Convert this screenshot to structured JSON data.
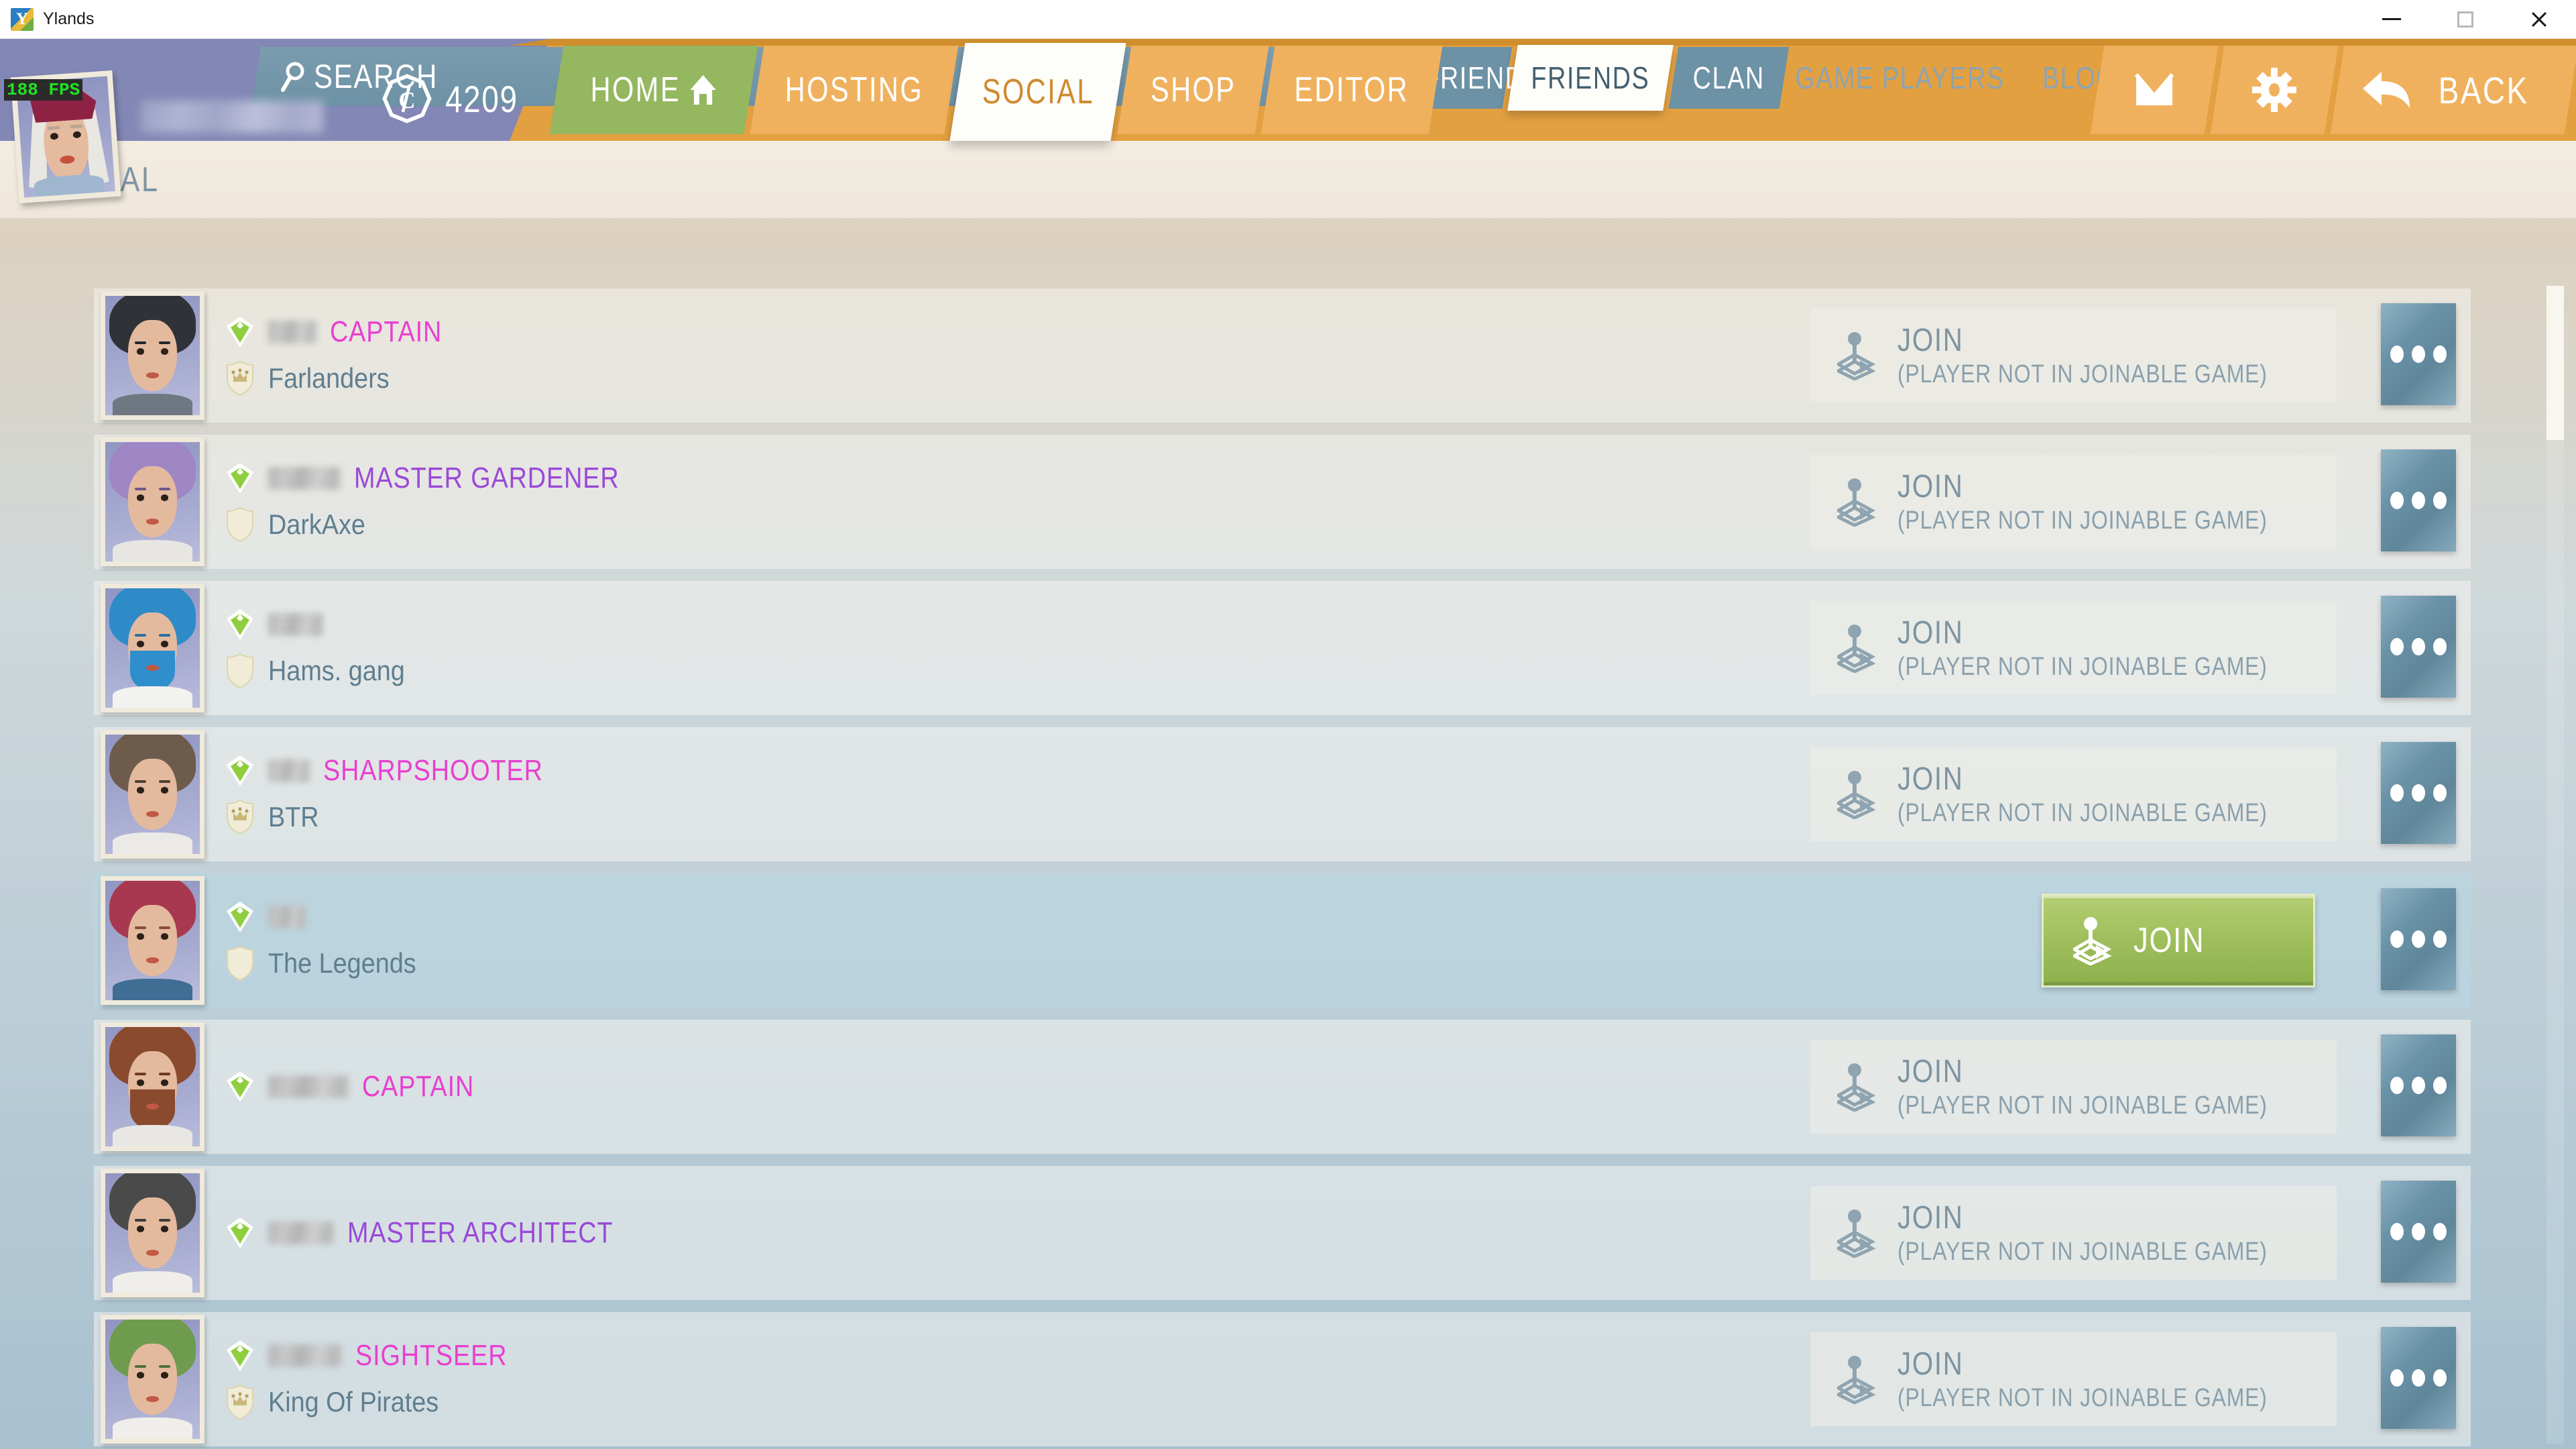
{
  "window": {
    "title": "Ylands",
    "app_icon": "ylands-logo-icon",
    "minimize": "minimize-icon",
    "maximize": "maximize-icon",
    "close": "close-icon"
  },
  "hud": {
    "fps": "188 FPS",
    "avatar": "player-avatar",
    "username": "",
    "currency_icon": "coin-icon",
    "currency_value": "4209"
  },
  "mainnav": {
    "tabs": [
      {
        "label": "HOME",
        "state": "home",
        "icon": "house-icon"
      },
      {
        "label": "HOSTING",
        "state": "orange",
        "icon": ""
      },
      {
        "label": "SOCIAL",
        "state": "active",
        "icon": ""
      },
      {
        "label": "SHOP",
        "state": "orange",
        "icon": ""
      },
      {
        "label": "EDITOR",
        "state": "orange",
        "icon": ""
      }
    ],
    "mail_icon": "mail-icon",
    "settings_icon": "gear-icon",
    "back_icon": "back-arrow-icon",
    "back_label": "BACK"
  },
  "subnav": {
    "breadcrumb": "SOCIAL",
    "search": {
      "icon": "search-icon",
      "placeholder": "SEARCH",
      "value": ""
    },
    "tabs": [
      {
        "label": "ADD NEW FRIEND",
        "state": "normal",
        "w": "w-addfriend"
      },
      {
        "label": "FRIENDS",
        "state": "active",
        "w": "w-friends"
      },
      {
        "label": "CLAN",
        "state": "normal",
        "w": "w-clan"
      },
      {
        "label": "GAME PLAYERS",
        "state": "disabled",
        "w": "w-gplayers"
      },
      {
        "label": "BLOCKED",
        "state": "disabled",
        "w": "w-blocked"
      }
    ]
  },
  "colors": {
    "rank_magenta": "#e93fd0",
    "rank_purple": "#9a49d8",
    "accent_orange": "#e3a040",
    "accent_green": "#94b760",
    "steel_blue": "#6d91a5",
    "clan_text": "#5f7e8f"
  },
  "friends_list": {
    "join_label": "JOIN",
    "join_disabled_note": "(PLAYER NOT IN JOINABLE GAME)",
    "more_button": "more-options-icon",
    "rows": [
      {
        "username": "",
        "name_blur_width": 72,
        "rank": "CAPTAIN",
        "rank_color": "magenta",
        "clan": "Farlanders",
        "clan_role": "leader",
        "status": "online",
        "joinable": false,
        "highlighted": false,
        "avatar": {
          "hair": "#2f3337",
          "brow": "#23272b",
          "body": "#6f7882",
          "beard": ""
        }
      },
      {
        "username": "",
        "name_blur_width": 108,
        "rank": "MASTER GARDENER",
        "rank_color": "purple",
        "clan": "DarkAxe",
        "clan_role": "member",
        "status": "online",
        "joinable": false,
        "highlighted": false,
        "avatar": {
          "hair": "#9f86c4",
          "brow": "#6d5a8a",
          "body": "#e8e6e2",
          "beard": ""
        }
      },
      {
        "username": "",
        "name_blur_width": 82,
        "rank": "",
        "rank_color": "magenta",
        "clan": "Hams. gang",
        "clan_role": "member",
        "status": "online",
        "joinable": false,
        "highlighted": false,
        "avatar": {
          "hair": "#2e8bc8",
          "brow": "#2a6f9e",
          "body": "#f2f2f0",
          "beard": "#2f8fcc"
        }
      },
      {
        "username": "",
        "name_blur_width": 62,
        "rank": "SHARPSHOOTER",
        "rank_color": "magenta",
        "clan": "BTR",
        "clan_role": "leader",
        "status": "online",
        "joinable": false,
        "highlighted": false,
        "avatar": {
          "hair": "#6d5b4c",
          "brow": "#4d4034",
          "body": "#eceae6",
          "beard": ""
        }
      },
      {
        "username": "",
        "name_blur_width": 56,
        "rank": "",
        "rank_color": "magenta",
        "clan": "The Legends",
        "clan_role": "member",
        "status": "online",
        "joinable": true,
        "highlighted": true,
        "avatar": {
          "hair": "#a8384f",
          "brow": "#8b4a3a",
          "body": "#3f6d94",
          "beard": ""
        }
      },
      {
        "username": "",
        "name_blur_width": 120,
        "rank": "CAPTAIN",
        "rank_color": "magenta",
        "clan": "",
        "clan_role": "none",
        "status": "online",
        "joinable": false,
        "highlighted": false,
        "avatar": {
          "hair": "#8a4a2e",
          "brow": "#6b3a22",
          "body": "#e9e7e3",
          "beard": "#8a4a2e"
        }
      },
      {
        "username": "",
        "name_blur_width": 98,
        "rank": "MASTER ARCHITECT",
        "rank_color": "purple",
        "clan": "",
        "clan_role": "none",
        "status": "online",
        "joinable": false,
        "highlighted": false,
        "avatar": {
          "hair": "#4a4a4a",
          "brow": "#3a3a3a",
          "body": "#efeeea",
          "beard": ""
        }
      },
      {
        "username": "",
        "name_blur_width": 110,
        "rank": "SIGHTSEER",
        "rank_color": "magenta",
        "clan": "King Of Pirates",
        "clan_role": "leader",
        "status": "online",
        "joinable": false,
        "highlighted": false,
        "avatar": {
          "hair": "#6f9b4e",
          "brow": "#4f7038",
          "body": "#efeeea",
          "beard": ""
        }
      }
    ]
  },
  "scrollbar": {
    "thumb_position_pct": 0
  }
}
